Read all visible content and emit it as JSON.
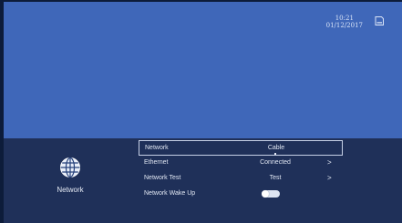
{
  "status": {
    "time": "10:21",
    "date": "01/12/2017",
    "storage_icon": "sd-card-icon"
  },
  "sidebar": {
    "icon": "globe-icon",
    "label": "Network"
  },
  "menu": {
    "rows": [
      {
        "label": "Network",
        "value": "Cable"
      },
      {
        "label": "Ethernet",
        "value": "Connected",
        "arrow": ">"
      },
      {
        "label": "Network Test",
        "value": "Test",
        "arrow": ">"
      },
      {
        "label": "Network Wake Up",
        "toggle_on": false
      }
    ]
  },
  "colors": {
    "background": "#3f67b9",
    "panel": "#1f3059",
    "text": "#e1e7f3"
  }
}
